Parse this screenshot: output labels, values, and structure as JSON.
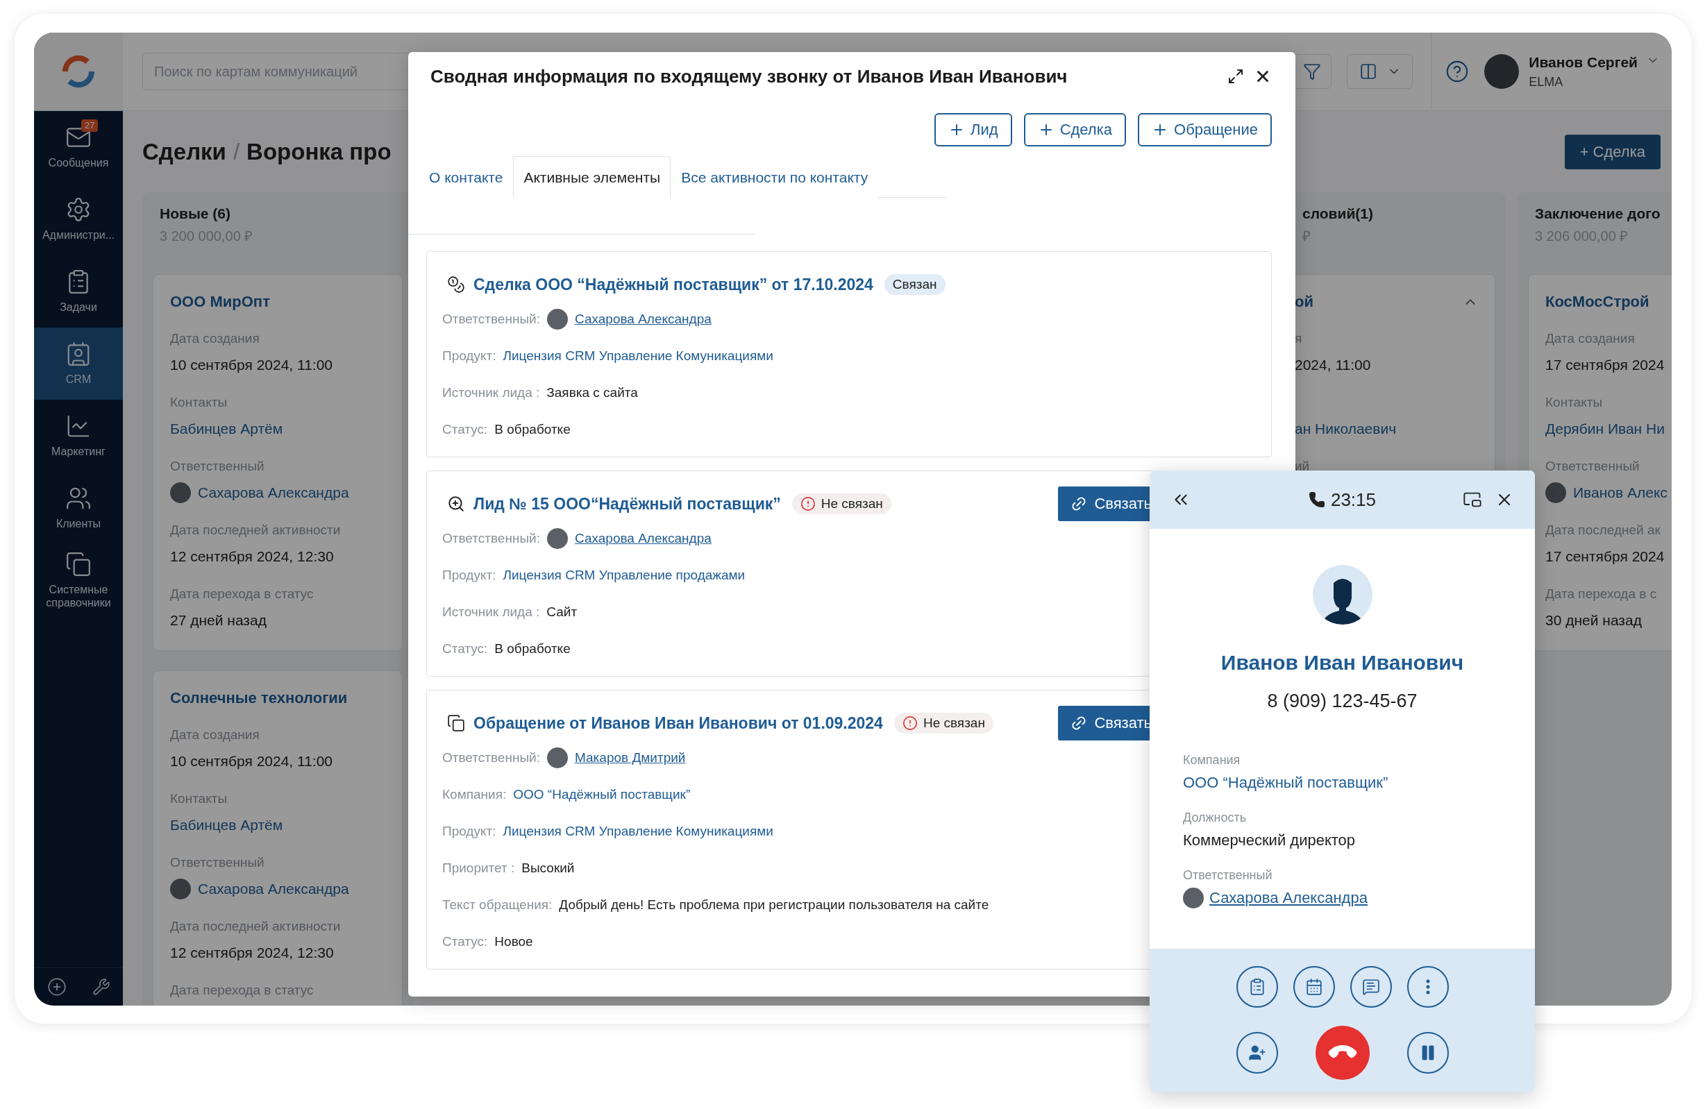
{
  "sidebar": {
    "items": [
      {
        "label": "Сообщения",
        "badge": "27",
        "selected": false
      },
      {
        "label": "Администри...",
        "selected": false
      },
      {
        "label": "Задачи",
        "selected": false
      },
      {
        "label": "CRM",
        "selected": true
      },
      {
        "label": "Маркетинг",
        "selected": false
      },
      {
        "label": "Клиенты",
        "selected": false
      },
      {
        "label": "Системные справочники",
        "selected": false
      }
    ]
  },
  "topbar": {
    "search": {
      "placeholder": "Поиск по картам коммуникаций"
    },
    "user": {
      "name": "Иванов Сергей",
      "org": "ELMA"
    }
  },
  "page": {
    "title": "Сделки",
    "separator": "/",
    "subtitle": "Воронка про",
    "add_button": "+ Сделка"
  },
  "board": {
    "columns": [
      {
        "title": "Новые (6)",
        "sum": "3 200 000,00 ₽",
        "cards": [
          {
            "title": "ООО МирОпт",
            "fields": [
              {
                "kind": "text",
                "label": "Дата создания",
                "value": "10 сентября 2024, 11:00"
              },
              {
                "kind": "link",
                "label": "Контакты",
                "value": "Бабинцев Артём"
              },
              {
                "kind": "person",
                "label": "Ответственный",
                "value": "Сахарова Александра"
              },
              {
                "kind": "text",
                "label": "Дата последней активности",
                "value": "12 сентября 2024, 12:30"
              },
              {
                "kind": "text",
                "label": "Дата перехода в статус",
                "value": "27 дней назад"
              }
            ]
          },
          {
            "title": "Солнечные технологии",
            "fields": [
              {
                "kind": "text",
                "label": "Дата создания",
                "value": "10 сентября 2024, 11:00"
              },
              {
                "kind": "link",
                "label": "Контакты",
                "value": "Бабинцев Артём"
              },
              {
                "kind": "person",
                "label": "Ответственный",
                "value": "Сахарова Александра"
              },
              {
                "kind": "text",
                "label": "Дата последней активности",
                "value": "12 сентября 2024, 12:30"
              },
              {
                "label": "Дата перехода в статус"
              }
            ]
          }
        ]
      },
      {
        "title": "словий(1)",
        "sum": "₽",
        "cards": [
          {
            "title": "ой",
            "expanded": true,
            "fields": [
              {
                "kind": "text",
                "label": "я",
                "value": "2024, 11:00"
              },
              {
                "kind": "link",
                "value": "ан Николаевич"
              },
              {
                "label": "ий"
              }
            ]
          }
        ]
      },
      {
        "title": "Заключение дого",
        "sum": "3 206 000,00 ₽",
        "cards": [
          {
            "title": "КосМосСтрой",
            "fields": [
              {
                "kind": "text",
                "label": "Дата создания",
                "value": "17 сентября 2024"
              },
              {
                "kind": "link",
                "label": "Контакты",
                "value": "Дерябин Иван Ни"
              },
              {
                "kind": "person",
                "label": "Ответственный",
                "value": "Иванов Алекс"
              },
              {
                "kind": "text",
                "label": "Дата последней ак",
                "value": "17 сентября 2024"
              },
              {
                "kind": "text",
                "label": "Дата перехода в с",
                "value": "30 дней назад"
              }
            ]
          }
        ]
      }
    ]
  },
  "modal": {
    "title": "Сводная информация по входящему звонку от Иванов Иван Иванович",
    "create_buttons": [
      "Лид",
      "Сделка",
      "Обращение"
    ],
    "tabs": [
      {
        "label": "О контакте",
        "selected": false
      },
      {
        "label": "Активные элементы",
        "selected": true
      },
      {
        "label": "Все активности по контакту",
        "selected": false
      }
    ],
    "items": [
      {
        "kind": "deal",
        "title": "Сделка ООО “Надёжный поставщик” от 17.10.2024",
        "status": {
          "label": "Связан",
          "linked": true
        },
        "fields": [
          {
            "kind": "person",
            "label": "Ответственный:",
            "value": "Сахарова Александра"
          },
          {
            "kind": "link",
            "label": "Продукт:",
            "value": "Лицензия CRM Управление Комуникациями"
          },
          {
            "kind": "text",
            "label": "Источник лида :",
            "value": "Заявка с сайта"
          },
          {
            "kind": "text",
            "label": "Статус:",
            "value": "В обработке"
          }
        ]
      },
      {
        "kind": "lead",
        "title": "Лид № 15 ООО“Надёжный поставщик”",
        "status": {
          "label": "Не связан",
          "linked": false
        },
        "action": "Связать",
        "fields": [
          {
            "kind": "person",
            "label": "Ответственный:",
            "value": "Сахарова Александра"
          },
          {
            "kind": "link",
            "label": "Продукт:",
            "value": "Лицензия CRM Управление продажами"
          },
          {
            "kind": "text",
            "label": "Источник лида :",
            "value": "Сайт"
          },
          {
            "kind": "text",
            "label": "Статус:",
            "value": "В обработке"
          }
        ]
      },
      {
        "kind": "appeal",
        "title": "Обращение от Иванов Иван Иванович от 01.09.2024",
        "status": {
          "label": "Не связан",
          "linked": false
        },
        "action": "Связать",
        "fields": [
          {
            "kind": "person",
            "label": "Ответственный:",
            "value": "Макаров Дмитрий"
          },
          {
            "kind": "link",
            "label": "Компания:",
            "value": "ООО “Надёжный поставщик”"
          },
          {
            "kind": "link",
            "label": "Продукт:",
            "value": "Лицензия CRM Управление Комуникациями"
          },
          {
            "kind": "text",
            "label": "Приоритет :",
            "value": "Высокий"
          },
          {
            "kind": "text",
            "label": "Текст обращения:",
            "value": "Добрый день! Есть проблема при регистрации пользователя на сайте"
          },
          {
            "kind": "text",
            "label": "Статус:",
            "value": "Новое"
          }
        ]
      }
    ]
  },
  "call": {
    "timer": "23:15",
    "name": "Иванов Иван Иванович",
    "phone": "8 (909) 123-45-67",
    "fields": [
      {
        "kind": "link",
        "label": "Компания",
        "value": "ООО “Надёжный поставщик”"
      },
      {
        "kind": "text",
        "label": "Должность",
        "value": "Коммерческий директор"
      },
      {
        "kind": "person",
        "label": "Ответственный",
        "value": "Сахарова Александра"
      }
    ]
  }
}
